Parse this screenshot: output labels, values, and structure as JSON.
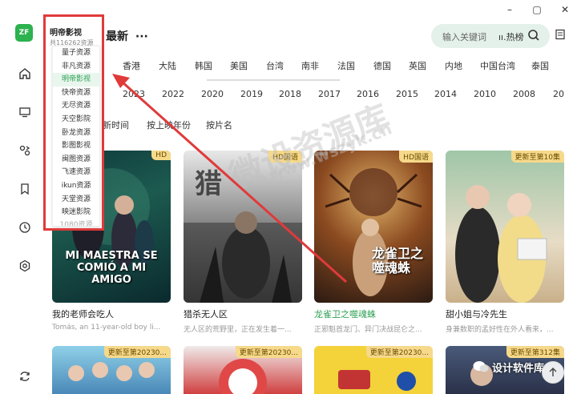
{
  "window": {
    "minimize": "–",
    "maximize": "▢",
    "close": "✕"
  },
  "logo": {
    "text": "ZF"
  },
  "header": {
    "title": "最新",
    "more": "···"
  },
  "search": {
    "placeholder": "输入关键词",
    "hot": "ıı.热榜"
  },
  "source_dropdown": {
    "title": "明帝影视",
    "count": "共116262资源",
    "items": [
      "量子资源",
      "非凡资源",
      "明帝影视",
      "快帝资源",
      "无尽资源",
      "天空影院",
      "卧龙资源",
      "影图影视",
      "闽图资源",
      "飞速资源",
      "ikun资源",
      "天堂资源",
      "映迷影院",
      "1080资源"
    ],
    "active": "明帝影视"
  },
  "filters": {
    "regions": [
      "香港",
      "大陆",
      "韩国",
      "美国",
      "台湾",
      "南非",
      "法国",
      "德国",
      "英国",
      "内地",
      "中国台湾",
      "泰国"
    ],
    "years": [
      "2023",
      "2022",
      "2020",
      "2019",
      "2018",
      "2017",
      "2016",
      "2015",
      "2014",
      "2010",
      "2008",
      "20"
    ],
    "sorts": [
      "新时间",
      "按上映年份",
      "按片名"
    ]
  },
  "cards": [
    {
      "title": "我的老师会吃人",
      "desc": "Tomás, an 11-year-old boy li...",
      "tag": "HD",
      "poster_text": "MI MAESTRA SE COMIÓ A MI AMIGO",
      "highlight": false
    },
    {
      "title": "猎杀无人区",
      "desc": "无人区的荒野里，正在发生着一...",
      "tag": "HD国语",
      "poster_text": "猎",
      "highlight": false
    },
    {
      "title": "龙雀卫之噬魂蛛",
      "desc": "正邪魁首龙门、异门决战昆仑之...",
      "tag": "HD国语",
      "poster_text": "龙雀卫之噬魂蛛",
      "highlight": true
    },
    {
      "title": "甜小姐与冷先生",
      "desc": "身兼数职的孟好性在外人看来，...",
      "tag": "更新至第10集",
      "poster_text": "",
      "highlight": false
    }
  ],
  "bottom_cards": [
    {
      "tag": "更新至第20230..."
    },
    {
      "tag": "更新至第20230..."
    },
    {
      "tag": "更新至第20230..."
    },
    {
      "tag": "更新至第312集"
    }
  ],
  "watermark": {
    "main": "微设资源库",
    "url": "www.wszyk.cn"
  },
  "wechat": {
    "label": "设计软件库"
  },
  "colors": {
    "accent": "#2da155",
    "annotation": "#e03a3a",
    "tag_bg": "#f6d98a"
  }
}
